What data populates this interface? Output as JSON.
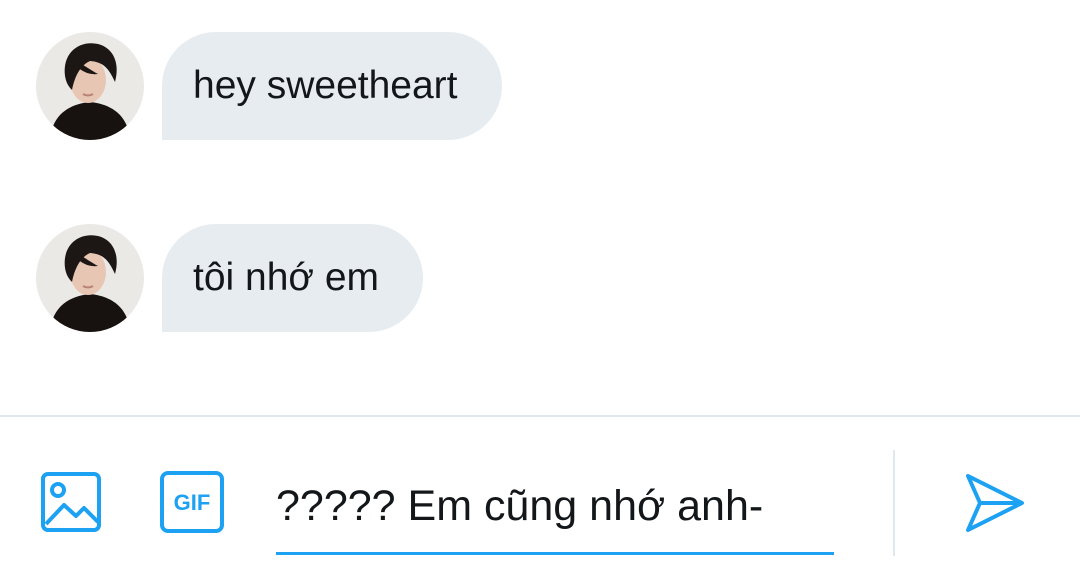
{
  "conversation": {
    "messages": [
      {
        "sender_avatar": "avatar",
        "text": "hey sweetheart"
      },
      {
        "sender_avatar": "avatar",
        "text": "tôi nhớ em"
      }
    ]
  },
  "composer": {
    "media_icon": "image-icon",
    "gif_icon": "gif-icon",
    "gif_label": "GIF",
    "input_value": "????? Em cũng nhớ anh-",
    "send_icon": "send-icon"
  },
  "colors": {
    "accent": "#1da1f2",
    "bubble_background": "#e6ecf0",
    "divider": "#e1e8ed",
    "text": "#14171a"
  }
}
